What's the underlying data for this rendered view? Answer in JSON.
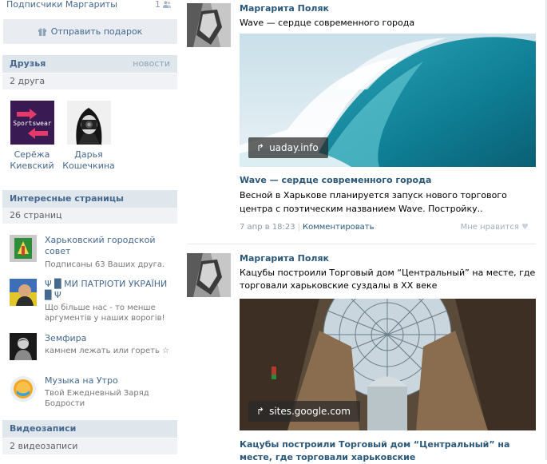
{
  "subscribers": {
    "label": "Подписчики Маргариты",
    "count": "1"
  },
  "gift_button": {
    "label": "Отправить подарок"
  },
  "friends_block": {
    "title": "Друзья",
    "more": "новости",
    "subtitle": "2 друга",
    "items": [
      {
        "first": "Серёжа",
        "last": "Киевский",
        "badge_text": "Sportswear"
      },
      {
        "first": "Дарья",
        "last": "Кошечкина"
      }
    ]
  },
  "pages_block": {
    "title": "Интересные страницы",
    "subtitle": "26 страниц",
    "items": [
      {
        "name": "Харьковский городской совет",
        "desc": "Подписаны 63 Ваших друга."
      },
      {
        "name": "Ψ █ МИ ПАТРІОТИ УКРАЇНИ █ Ψ",
        "desc": "Що більше нас - то менше аргументів у наших ворогів!"
      },
      {
        "name": "Земфира",
        "desc": "камнем лежать или гореть ☆"
      },
      {
        "name": "Музыка на Утро",
        "desc": "Твой Ежедневный Заряд Бодрости"
      }
    ]
  },
  "videos_block": {
    "title": "Видеозаписи",
    "subtitle": "2 видеозаписи"
  },
  "posts": [
    {
      "author": "Маргарита Поляк",
      "text": "Wave — сердце современного города",
      "source": "uaday.info",
      "link_title": "Wave — сердце современного города",
      "link_desc": "Весной в Харькове планируется запуск нового торгового центра с поэтическим названием Wave. Постройку..",
      "date": "7 апр в 18:23",
      "comment": "Комментировать",
      "like": "Мне нравится"
    },
    {
      "author": "Маргарита Поляк",
      "text": "Кацубы построили Торговый дом “Центральный” на месте, где торговали харьковские суздалы в XX веке",
      "source": "sites.google.com",
      "link_title": "Кацубы построили Торговый дом “Центральный” на месте, где торговали харьковские"
    }
  ],
  "colors": {
    "link": "#2b587a",
    "header_bg": "#dfe6ec",
    "sub_bg": "#f0f2f5"
  }
}
